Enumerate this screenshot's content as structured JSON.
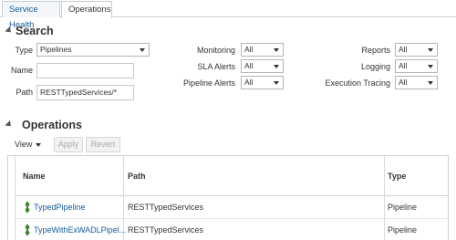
{
  "tabs": [
    {
      "label": "Service Health",
      "active": false
    },
    {
      "label": "Operations",
      "active": true
    }
  ],
  "search": {
    "heading": "Search",
    "type_label": "Type",
    "type_value": "Pipelines",
    "name_label": "Name",
    "name_value": "",
    "path_label": "Path",
    "path_value": "RESTTypedServices/*",
    "monitoring_label": "Monitoring",
    "monitoring_value": "All",
    "sla_label": "SLA Alerts",
    "sla_value": "All",
    "pipeline_alerts_label": "Pipeline Alerts",
    "pipeline_alerts_value": "All",
    "reports_label": "Reports",
    "reports_value": "All",
    "logging_label": "Logging",
    "logging_value": "All",
    "tracing_label": "Execution Tracing",
    "tracing_value": "All"
  },
  "operations": {
    "heading": "Operations",
    "view_label": "View",
    "apply_label": "Apply",
    "revert_label": "Revert",
    "columns": [
      "Name",
      "Path",
      "Type"
    ],
    "rows": [
      {
        "name": "TypedPipeline",
        "path": "RESTTypedServices",
        "type": "Pipeline"
      },
      {
        "name": "TypeWithExWADLPipel...",
        "path": "RESTTypedServices",
        "type": "Pipeline"
      }
    ]
  },
  "colors": {
    "link": "#145c9e",
    "border": "#c4ced7",
    "icon_green": "#3a8a2a"
  }
}
